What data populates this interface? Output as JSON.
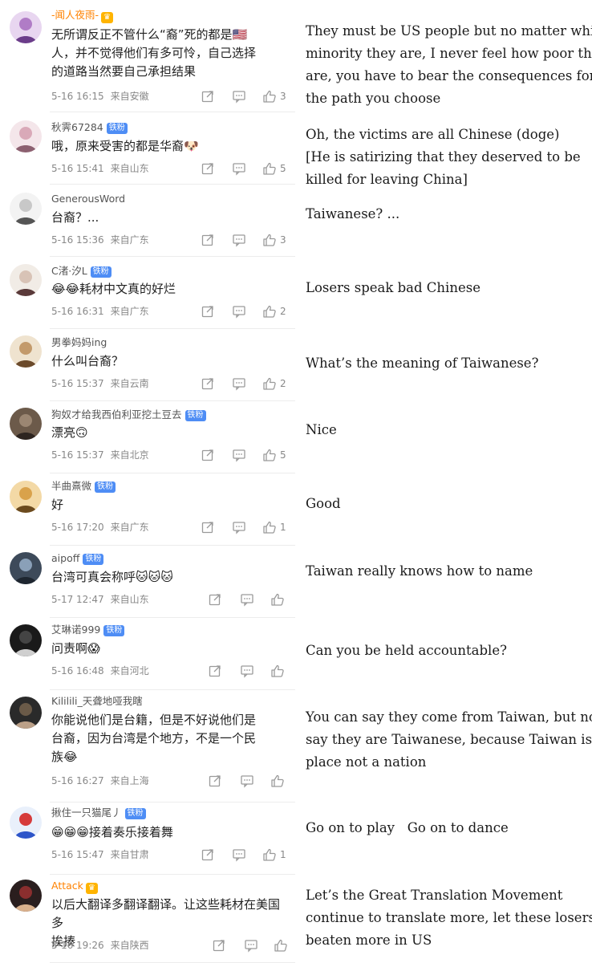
{
  "comments": [
    {
      "user": "-闻人夜雨-",
      "user_style": "orange",
      "badge": "",
      "crown": true,
      "text_lines": [
        "无所谓反正不管什么“裔”死的都是🇺🇸",
        "人，并不觉得他们有多可怜，自己选择",
        "的道路当然要自己承担结果"
      ],
      "time": "5-16 16:15",
      "location": "来自安徽",
      "likes": "3",
      "translation_lines": [
        "They must be US people but no matter which",
        "minority they are, I never feel how poor they",
        "are, you have to bear the consequences for",
        "the path you choose"
      ]
    },
    {
      "user": "秋霁67284",
      "user_style": "",
      "badge": "铁粉",
      "crown": false,
      "text_lines": [
        "哦，原来受害的都是华裔🐶"
      ],
      "time": "5-16 15:41",
      "location": "来自山东",
      "likes": "5",
      "translation_lines": [
        "Oh, the victims are all Chinese (doge)",
        "[He is satirizing that they deserved to be",
        "killed for leaving China]"
      ]
    },
    {
      "user": "GenerousWord",
      "user_style": "",
      "badge": "",
      "crown": false,
      "text_lines": [
        "台裔？..."
      ],
      "time": "5-16 15:36",
      "location": "来自广东",
      "likes": "3",
      "translation_lines": [
        "Taiwanese? ..."
      ]
    },
    {
      "user": "C渚·汐L",
      "user_style": "",
      "badge": "铁粉",
      "crown": false,
      "text_lines": [
        "😂😂耗材中文真的好烂"
      ],
      "time": "5-16 16:31",
      "location": "来自广东",
      "likes": "2",
      "translation_lines": [
        "Losers speak bad Chinese"
      ]
    },
    {
      "user": "男拳妈妈ing",
      "user_style": "",
      "badge": "",
      "crown": false,
      "text_lines": [
        "什么叫台裔？"
      ],
      "time": "5-16 15:37",
      "location": "来自云南",
      "likes": "2",
      "translation_lines": [
        "What’s the meaning of Taiwanese?"
      ]
    },
    {
      "user": "狗奴才给我西伯利亚挖土豆去",
      "user_style": "",
      "badge": "铁粉",
      "crown": false,
      "text_lines": [
        "漂亮🙃"
      ],
      "time": "5-16 15:37",
      "location": "来自北京",
      "likes": "5",
      "translation_lines": [
        "Nice"
      ]
    },
    {
      "user": "半曲熹微",
      "user_style": "",
      "badge": "铁粉",
      "crown": false,
      "text_lines": [
        "好"
      ],
      "time": "5-16 17:20",
      "location": "来自广东",
      "likes": "1",
      "translation_lines": [
        "Good"
      ]
    },
    {
      "user": "aipoff",
      "user_style": "",
      "badge": "铁粉",
      "crown": false,
      "text_lines": [
        "台湾可真会称呼🐱🐱🐱"
      ],
      "time": "5-17 12:47",
      "location": "来自山东",
      "likes": "",
      "translation_lines": [
        "Taiwan really knows how to name"
      ]
    },
    {
      "user": "艾琳诺999",
      "user_style": "",
      "badge": "铁粉",
      "crown": false,
      "text_lines": [
        "问责啊😱"
      ],
      "time": "5-16 16:48",
      "location": "来自河北",
      "likes": "",
      "translation_lines": [
        "Can you be held accountable?"
      ]
    },
    {
      "user": "Kililili_天聋地哑我瞎",
      "user_style": "",
      "badge": "",
      "crown": false,
      "text_lines": [
        "你能说他们是台籍，但是不好说他们是",
        "台裔，因为台湾是个地方，不是一个民",
        "族😂"
      ],
      "time": "5-16 16:27",
      "location": "来自上海",
      "likes": "",
      "translation_lines": [
        "You can say they come from Taiwan, but not",
        "say they are Taiwanese, because Taiwan is a",
        "place not a nation"
      ]
    },
    {
      "user": "揪住一只猫尾丿",
      "user_style": "",
      "badge": "铁粉",
      "crown": false,
      "text_lines": [
        "😁😁😁接着奏乐接着舞"
      ],
      "time": "5-16 15:47",
      "location": "来自甘肃",
      "likes": "1",
      "translation_lines": [
        "Go on to play   Go on to dance"
      ]
    },
    {
      "user": "Attack",
      "user_style": "orange",
      "badge": "",
      "crown": true,
      "text_lines": [
        "以后大翻译多翻译翻译。让这些耗材在美国多",
        "挨揍"
      ],
      "time": "5-16 19:26",
      "location": "来自陕西",
      "likes": "",
      "translation_lines": [
        "Let’s the Great Translation Movement",
        "continue to translate more, let these losers get",
        "beaten more in US"
      ]
    }
  ]
}
